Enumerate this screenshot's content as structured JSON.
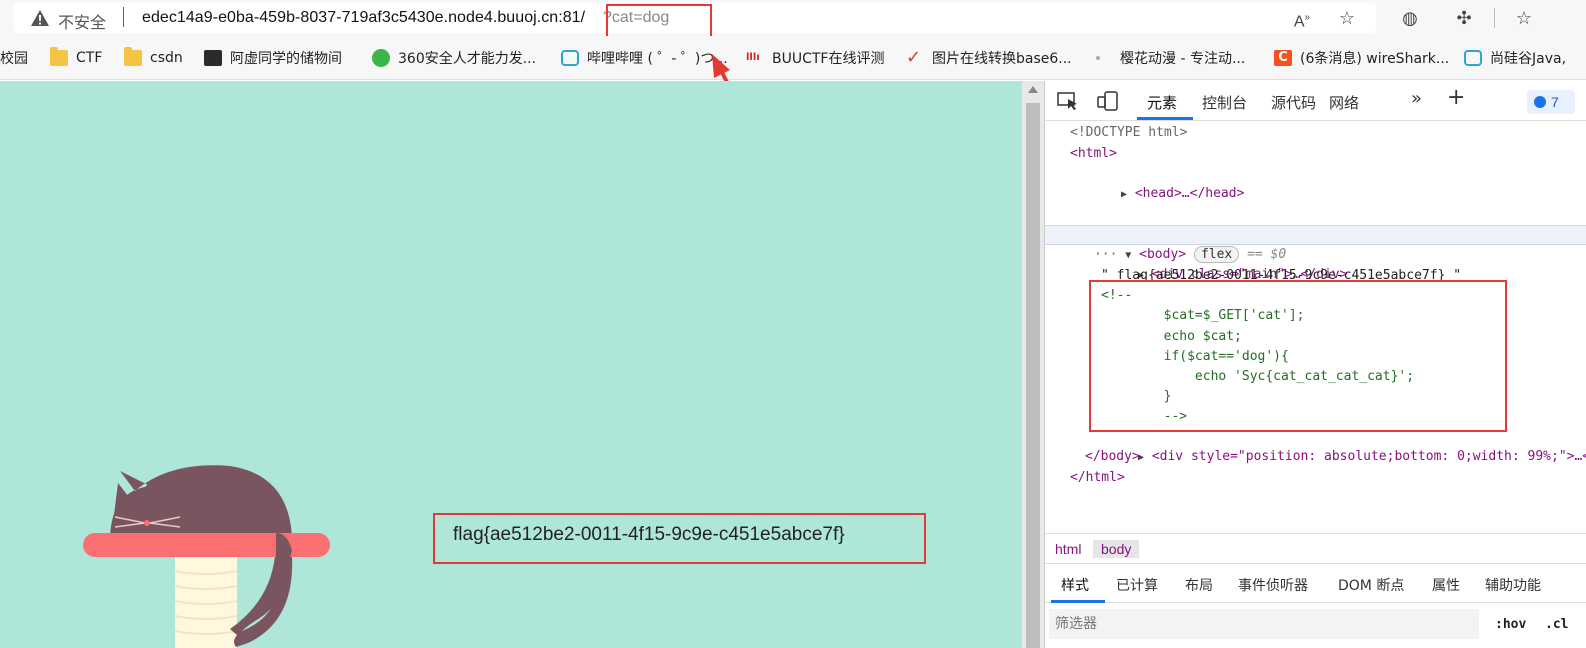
{
  "address_bar": {
    "insecure_label": "不安全",
    "url_host": "edec14a9-e0ba-459b-8037-719af3c5430e.node4.buuoj.cn:81/",
    "url_query": "?cat=dog"
  },
  "bookmarks": [
    {
      "label": "校园",
      "icon": "folder-icon"
    },
    {
      "label": "CTF",
      "icon": "folder-icon"
    },
    {
      "label": "csdn",
      "icon": "folder-icon"
    },
    {
      "label": "阿虚同学的储物间",
      "icon": "avatar-icon"
    },
    {
      "label": "360安全人才能力发...",
      "icon": "360-icon"
    },
    {
      "label": "哔哩哔哩 ( ゜- ゜)つ...",
      "icon": "bilibili-icon"
    },
    {
      "label": "BUUCTF在线评测",
      "icon": "buu-icon"
    },
    {
      "label": "图片在线转换base6...",
      "icon": "check-icon"
    },
    {
      "label": "樱花动漫 - 专注动...",
      "icon": "dot-icon"
    },
    {
      "label": "(6条消息) wireShark...",
      "icon": "csdn-c-icon"
    },
    {
      "label": "尚硅谷Java,",
      "icon": "bilibili-icon"
    }
  ],
  "page": {
    "flag_text": "flag{ae512be2-0011-4f15-9c9e-c451e5abce7f}"
  },
  "devtools": {
    "tabs": [
      "元素",
      "控制台",
      "源代码",
      "网络"
    ],
    "issues_count": "7",
    "dom": {
      "doctype": "<!DOCTYPE html>",
      "html_open": "<html>",
      "head": "<head>…</head>",
      "body_open": "<body>",
      "flex_pill": "flex",
      "eq0": "== $0",
      "div_main": "<div class=\"main\">…</div>",
      "text_node": "\" flag{ae512be2-0011-4f15-9c9e-c451e5abce7f} \"",
      "comment_lines": [
        "<!--",
        "        $cat=$_GET['cat'];",
        "        echo $cat;",
        "        if($cat=='dog'){",
        "            echo 'Syc{cat_cat_cat_cat}';",
        "        }",
        "        -->"
      ],
      "div_style": "<div style=\"position: absolute;bottom: 0;width: 99%;\">…</",
      "body_close": "</body>",
      "html_close": "</html>"
    },
    "breadcrumbs": [
      "html",
      "body"
    ],
    "style_tabs": [
      "样式",
      "已计算",
      "布局",
      "事件侦听器",
      "DOM 断点",
      "属性",
      "辅助功能"
    ],
    "filter_placeholder": "筛选器",
    "hov_label": ":hov",
    "cls_label": ".cl"
  },
  "colors": {
    "page_bg": "#aee6da",
    "highlight": "#e53935",
    "cat": "#7a5560",
    "perch": "#fa6f72",
    "post": "#fff8dc"
  }
}
